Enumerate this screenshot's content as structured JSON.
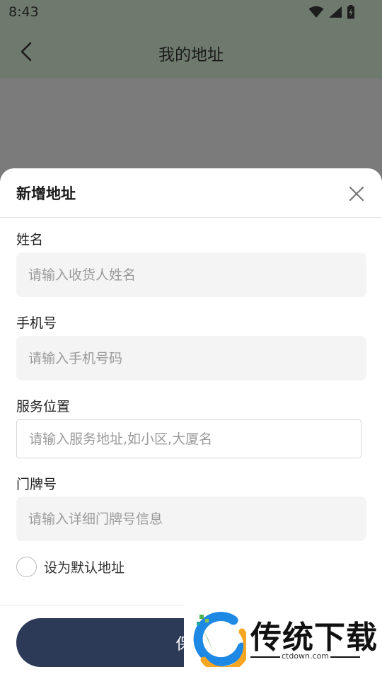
{
  "status": {
    "time": "8:43"
  },
  "header": {
    "title": "我的地址"
  },
  "sheet": {
    "title": "新增地址",
    "fields": [
      {
        "label": "姓名",
        "placeholder": "请输入收货人姓名"
      },
      {
        "label": "手机号",
        "placeholder": "请输入手机号码"
      },
      {
        "label": "服务位置",
        "placeholder": "请输入服务地址,如小区,大厦名"
      },
      {
        "label": "门牌号",
        "placeholder": "请输入详细门牌号信息"
      }
    ],
    "default_label": "设为默认地址",
    "save_label": "保存"
  },
  "watermark": {
    "text": "传统下载",
    "sub": "ctdown.com"
  },
  "icons": {
    "back": "chevron-left-icon",
    "close": "close-icon",
    "wifi": "wifi-icon",
    "signal": "signal-icon",
    "battery": "battery-icon"
  }
}
